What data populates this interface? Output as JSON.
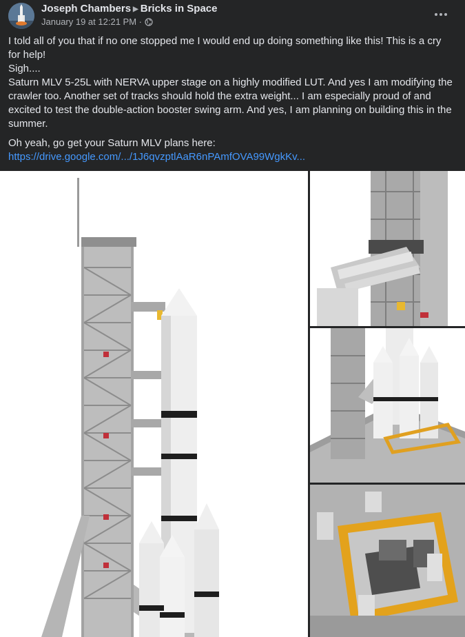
{
  "post": {
    "author": "Joseph Chambers",
    "group": "Bricks in Space",
    "timestamp": "January 19 at 12:21 PM",
    "separator": "·",
    "more_label": "•••",
    "paragraphs": [
      "I told all of you that if no one stopped me I would end up doing something like this! This is a cry for help!",
      "Sigh....",
      "Saturn MLV 5-25L with NERVA upper stage on a highly modified LUT. And yes I am modifying the crawler too. Another set of tracks should hold the extra weight... I am especially proud of and excited to test the double-action booster swing arm. And yes, I am planning on building this in the summer."
    ],
    "link_intro": "Oh yeah, go get your Saturn MLV plans here:",
    "link_text": "https://drive.google.com/.../1J6qvzptlAaR6nPAmfOVA99WgkKv..."
  },
  "icons": {
    "caret": "caret-right-icon",
    "privacy": "globe-icon",
    "more": "more-dots-icon"
  },
  "colors": {
    "background": "#242526",
    "text": "#e4e6eb",
    "secondary_text": "#b0b3b8",
    "link": "#4599ff"
  }
}
